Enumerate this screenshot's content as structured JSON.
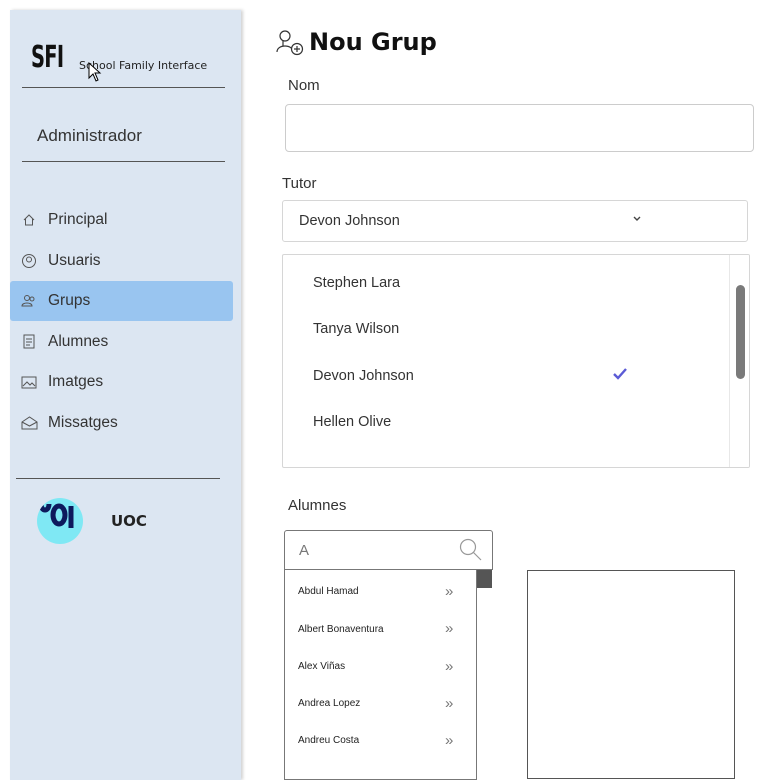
{
  "sidebar": {
    "logo": "SFI",
    "app_name": "School Family Interface",
    "role": "Administrador",
    "nav": [
      {
        "label": "Principal",
        "icon": "home-icon"
      },
      {
        "label": "Usuaris",
        "icon": "user-circle-icon"
      },
      {
        "label": "Grups",
        "icon": "group-icon",
        "active": true
      },
      {
        "label": "Alumnes",
        "icon": "document-icon"
      },
      {
        "label": "Imatges",
        "icon": "image-icon"
      },
      {
        "label": "Missatges",
        "icon": "mail-icon"
      }
    ],
    "org_name": "UOC"
  },
  "page": {
    "title": "Nou Grup",
    "name_label": "Nom",
    "name_value": "",
    "tutor_label": "Tutor",
    "tutor_selected": "Devon Johnson",
    "tutor_options": [
      "Stephen Lara",
      "Tanya Wilson",
      "Devon Johnson",
      "Hellen Olive"
    ],
    "students_label": "Alumnes",
    "students_search": "A",
    "students": [
      "Abdul Hamad",
      "Albert Bonaventura",
      "Alex Viñas",
      "Andrea Lopez",
      "Andreu Costa"
    ],
    "add_arrow": "»"
  },
  "colors": {
    "sidebar_bg": "#dce6f2",
    "active_item": "#99c5f0",
    "check": "#5b5bd6",
    "org_logo": "#7fe8f4"
  }
}
